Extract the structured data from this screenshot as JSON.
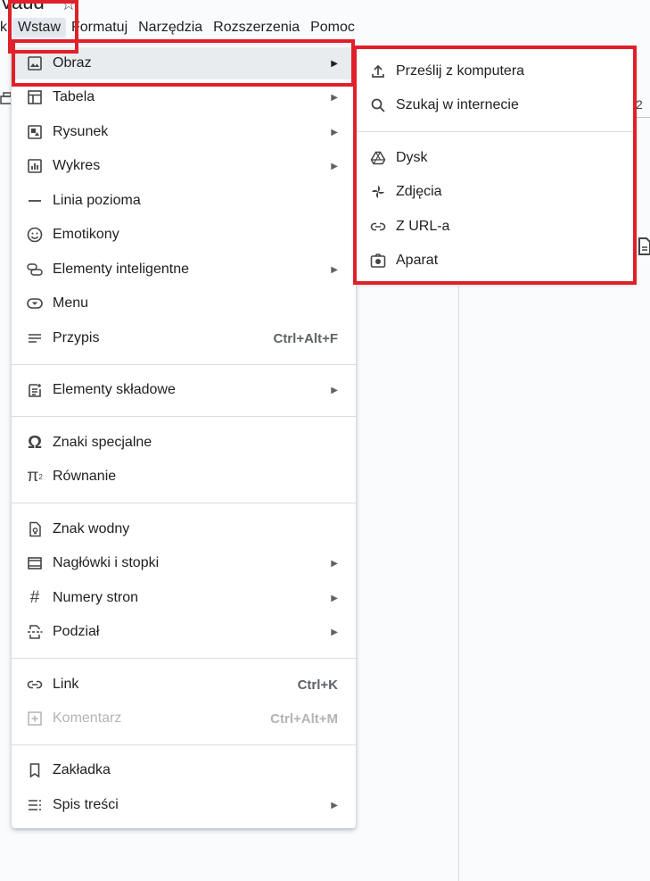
{
  "doc_title_fragment": "Vaud",
  "menubar": {
    "items": [
      {
        "label": "k"
      },
      {
        "label": "Wstaw"
      },
      {
        "label": "Formatuj"
      },
      {
        "label": "Narzędzia"
      },
      {
        "label": "Rozszerzenia"
      },
      {
        "label": "Pomoc"
      }
    ],
    "active": "Wstaw"
  },
  "ruler_number": "2",
  "insert_menu": {
    "items": [
      {
        "label": "Obraz",
        "icon": "image-icon",
        "submenu": true,
        "highlighted": true
      },
      {
        "label": "Tabela",
        "icon": "table-icon",
        "submenu": true
      },
      {
        "label": "Rysunek",
        "icon": "drawing-icon",
        "submenu": true
      },
      {
        "label": "Wykres",
        "icon": "chart-icon",
        "submenu": true
      },
      {
        "label": "Linia pozioma",
        "icon": "horizontal-line-icon"
      },
      {
        "label": "Emotikony",
        "icon": "emoji-icon"
      },
      {
        "label": "Elementy inteligentne",
        "icon": "smart-chips-icon",
        "submenu": true
      },
      {
        "label": "Menu",
        "icon": "dropdown-icon"
      },
      {
        "label": "Przypis",
        "icon": "footnote-icon",
        "shortcut": "Ctrl+Alt+F"
      },
      {
        "label": "Elementy składowe",
        "icon": "building-blocks-icon",
        "submenu": true
      },
      {
        "label": "Znaki specjalne",
        "icon": "omega-icon"
      },
      {
        "label": "Równanie",
        "icon": "pi-icon"
      },
      {
        "label": "Znak wodny",
        "icon": "watermark-icon"
      },
      {
        "label": "Nagłówki i stopki",
        "icon": "header-footer-icon",
        "submenu": true
      },
      {
        "label": "Numery stron",
        "icon": "hash-icon",
        "submenu": true
      },
      {
        "label": "Podział",
        "icon": "break-icon",
        "submenu": true
      },
      {
        "label": "Link",
        "icon": "link-icon",
        "shortcut": "Ctrl+K"
      },
      {
        "label": "Komentarz",
        "icon": "add-comment-icon",
        "shortcut": "Ctrl+Alt+M",
        "disabled": true
      },
      {
        "label": "Zakładka",
        "icon": "bookmark-icon"
      },
      {
        "label": "Spis treści",
        "icon": "table-of-contents-icon",
        "submenu": true
      }
    ]
  },
  "image_submenu": {
    "items": [
      {
        "label": "Prześlij z komputera",
        "icon": "upload-icon"
      },
      {
        "label": "Szukaj w internecie",
        "icon": "search-icon"
      },
      {
        "label": "Dysk",
        "icon": "drive-icon"
      },
      {
        "label": "Zdjęcia",
        "icon": "photos-pinwheel-icon"
      },
      {
        "label": "Z URL-a",
        "icon": "link-icon"
      },
      {
        "label": "Aparat",
        "icon": "camera-icon"
      }
    ]
  },
  "colors": {
    "annotation_red": "#e0202a",
    "highlight": "#e9ecef",
    "menu_bg": "#ffffff",
    "disabled_text": "#b4b4b4"
  }
}
